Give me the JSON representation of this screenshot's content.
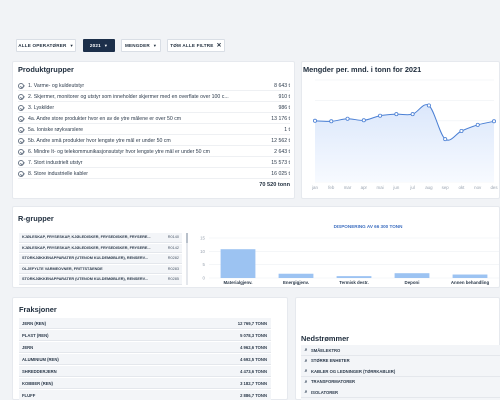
{
  "filters": {
    "operators": "ALLE OPERATØRER",
    "year": "2021",
    "quantities": "MENGDER",
    "clear": "TØM ALLE FILTRE"
  },
  "produktgrupper": {
    "title": "Produktgrupper",
    "items": [
      {
        "label": "1. Varme- og kuldeutstyr",
        "value": "8 643 t"
      },
      {
        "label": "2. Skjermer, monitorer og utstyr som inneholder skjermer med en overflate over 100 c...",
        "value": "910 t"
      },
      {
        "label": "3. Lyskilder",
        "value": "986 t"
      },
      {
        "label": "4a. Andre store produkter hvor en av de ytre målene er over 50 cm",
        "value": "13 176 t"
      },
      {
        "label": "5a. Ioniske røykvarslere",
        "value": "1 t"
      },
      {
        "label": "5b. Andre små produkter hvor lengste ytre mål er under 50 cm",
        "value": "12 562 t"
      },
      {
        "label": "6. Mindre It- og telekommunikasjonsutstyr hvor lengste ytre mål er under 50 cm",
        "value": "2 643 t"
      },
      {
        "label": "7. Stort industrielt utstyr",
        "value": "15 573 t"
      },
      {
        "label": "8. Store industrielle kabler",
        "value": "16 025 t"
      }
    ],
    "total": "70 520 tonn"
  },
  "mengder": {
    "title": "Mengder per. mnd. i tonn for 2021",
    "y_ticks": [
      "10 k",
      "8 k",
      "6 k",
      "4 k",
      "2 k",
      "0"
    ],
    "x_ticks": [
      "jan",
      "feb",
      "mar",
      "apr",
      "mai",
      "jun",
      "jul",
      "aug",
      "sep",
      "okt",
      "nov",
      "des"
    ]
  },
  "rgrupper": {
    "title": "R-grupper",
    "rows": [
      {
        "label": "KJØLESKAP, FRYSESKAP, KJØLEDISKER, FRYSEDISKER, FRYSERE...",
        "code": "R0140"
      },
      {
        "label": "KJØLESKAP, FRYSESKAP, KJØLEDISKER, FRYSEDISKER, FRYSERE...",
        "code": "R0142"
      },
      {
        "label": "STORKJØKKENAPPARATER (UTENOM KULDEMØBLER), RENSERV...",
        "code": "R0282"
      },
      {
        "label": "OLJEFYLTE VARMEOVNER, FRITTSTÅENDE",
        "code": "R0283"
      },
      {
        "label": "STORKJØKKENAPPARATER (UTENOM KULDEMØBLER), RENSERV...",
        "code": "R0285"
      }
    ],
    "chart_title": "DISPONERING AV 66 300 TONN",
    "y_ticks": [
      "15",
      "10",
      "5",
      "0"
    ],
    "categories": [
      "Materialgjenv.",
      "Energigjenv.",
      "Termisk destr.",
      "Deponi",
      "Annen behandling"
    ]
  },
  "fraksjoner": {
    "title": "Fraksjoner",
    "rows": [
      {
        "label": "JERN (REN)",
        "value": "12 769,7 TONN"
      },
      {
        "label": "PLAST (REN)",
        "value": "5 078,3 TONN"
      },
      {
        "label": "JERN",
        "value": "4 962,6 TONN"
      },
      {
        "label": "ALUMINIUM (REN)",
        "value": "4 692,5 TONN"
      },
      {
        "label": "SHREDDERJERN",
        "value": "4 473,6 TONN"
      },
      {
        "label": "KOBBER (REN)",
        "value": "3 182,7 TONN"
      },
      {
        "label": "FLUFF",
        "value": "2 886,7 TONN"
      }
    ]
  },
  "nedstrommer": {
    "title": "Nedstrømmer",
    "rows": [
      "SMÅELEKTRO",
      "STØRRE ENHETER",
      "KABLER OG LEDNINGER (TØRRKABLER)",
      "TRANSFORMATORER",
      "ISOLATORER",
      "OLJEFYLTE VARMEOVNER, FRITTSTÅENDE"
    ]
  },
  "chart_data": [
    {
      "type": "area",
      "title": "Mengder per. mnd. i tonn for 2021",
      "categories": [
        "jan",
        "feb",
        "mar",
        "apr",
        "mai",
        "jun",
        "jul",
        "aug",
        "sep",
        "okt",
        "nov",
        "des"
      ],
      "values": [
        6000,
        5950,
        6200,
        6050,
        6500,
        6650,
        6650,
        7500,
        4200,
        5000,
        5600,
        5950
      ],
      "ylim": [
        0,
        10000
      ],
      "grid": true
    },
    {
      "type": "bar",
      "title": "DISPONERING AV 66 300 TONN",
      "categories": [
        "Materialgjenv.",
        "Energigjenv.",
        "Termisk destr.",
        "Deponi",
        "Annen behandling"
      ],
      "values": [
        10.8,
        1.6,
        0.7,
        1.8,
        1.3
      ],
      "ylim": [
        0,
        15
      ],
      "grid": true
    }
  ],
  "colors": {
    "navy": "#1c2f4a",
    "line": "#4a7fd4",
    "area": "#e8f0fc",
    "bar": "#9cc3f2"
  }
}
